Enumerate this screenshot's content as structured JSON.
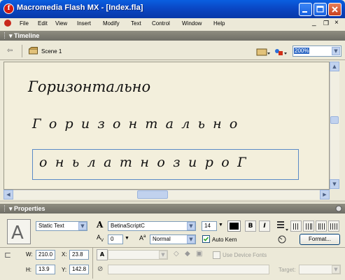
{
  "window": {
    "title": "Macromedia Flash MX - [Index.fla]",
    "icon_text": "f",
    "buttons": [
      "minimize",
      "maximize",
      "close"
    ]
  },
  "menu": {
    "items": [
      "File",
      "Edit",
      "View",
      "Insert",
      "Modify",
      "Text",
      "Control",
      "Window",
      "Help"
    ]
  },
  "timeline": {
    "label": "Timeline"
  },
  "editbar": {
    "scene": "Scene 1",
    "zoom": "200%"
  },
  "stage": {
    "text_horizontal": "Горизонтально",
    "text_spaced": "Г о р и з о н т а л ь н о",
    "text_reversed": "о н ь л а т н о з и р о Г"
  },
  "properties": {
    "label": "Properties",
    "text_type": "Static Text",
    "font": "BetinaScriptC",
    "font_size": "14",
    "bold_label": "B",
    "italic_label": "I",
    "kerning_value": "0",
    "position_mode": "Normal",
    "auto_kern_label": "Auto Kern",
    "use_device_fonts_label": "Use Device Fonts",
    "format_button": "Format...",
    "w_label": "W:",
    "w_value": "210.0",
    "x_label": "X:",
    "x_value": "23.8",
    "h_label": "H:",
    "h_value": "13.9",
    "y_label": "Y:",
    "y_value": "142.8",
    "target_label": "Target:",
    "auto_kern_checked": true,
    "text_color": "#000000"
  }
}
